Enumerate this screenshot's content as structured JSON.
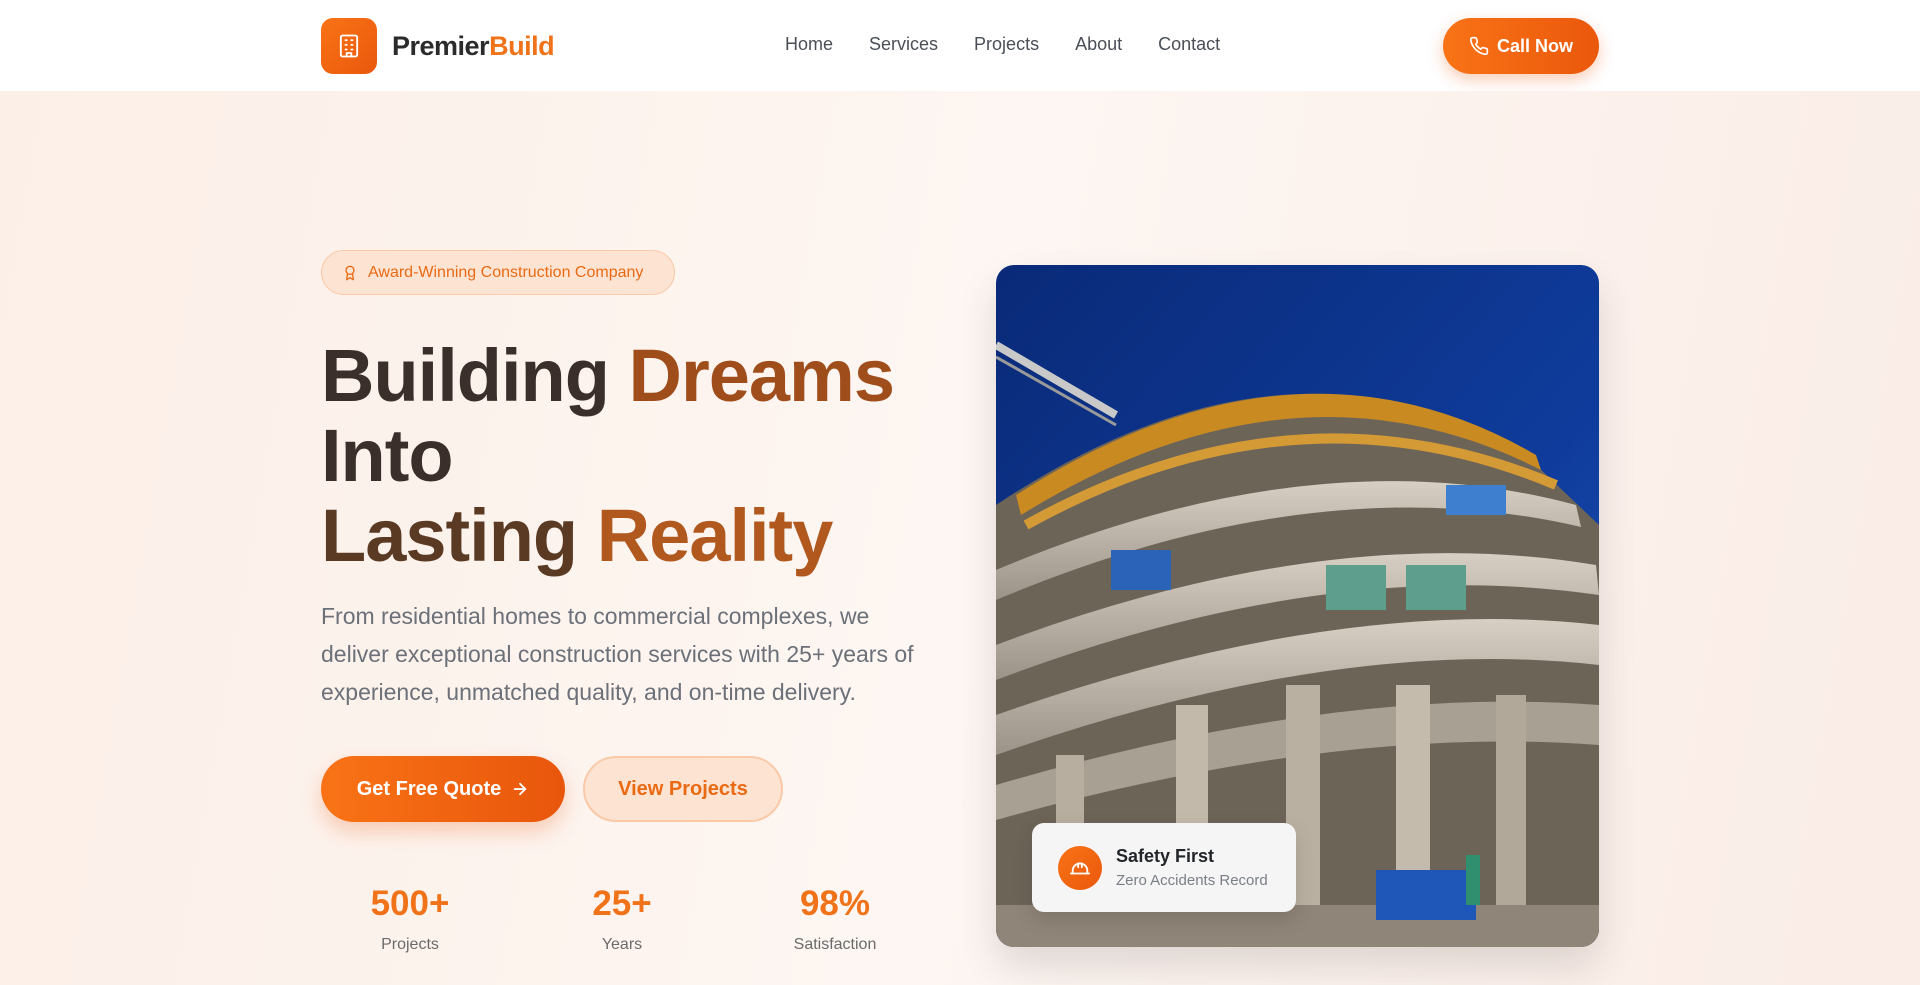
{
  "header": {
    "logo": {
      "part1": "Premier",
      "part2": "Build",
      "icon": "building-icon"
    },
    "nav": [
      {
        "label": "Home"
      },
      {
        "label": "Services"
      },
      {
        "label": "Projects"
      },
      {
        "label": "About"
      },
      {
        "label": "Contact"
      }
    ],
    "cta": {
      "label": "Call Now",
      "icon": "phone-icon"
    }
  },
  "hero": {
    "badge": {
      "label": "Award-Winning Construction Company",
      "icon": "award-icon"
    },
    "headline": {
      "line1_a": "Building",
      "line1_b": "Dreams",
      "line2": "Into",
      "line3_a": "Lasting",
      "line3_b": "Reality"
    },
    "description": "From residential homes to commercial complexes, we deliver exceptional construction services with 25+ years of experience, unmatched quality, and on-time delivery.",
    "primary_button": {
      "label": "Get Free Quote",
      "icon": "arrow-right-icon"
    },
    "secondary_button": {
      "label": "View Projects"
    },
    "stats": [
      {
        "value": "500+",
        "label": "Projects"
      },
      {
        "value": "25+",
        "label": "Years"
      },
      {
        "value": "98%",
        "label": "Satisfaction"
      }
    ],
    "photo": {
      "subject": "construction-site-image"
    },
    "safety_card": {
      "title": "Safety First",
      "subtitle": "Zero Accidents Record",
      "icon": "hard-hat-icon"
    }
  },
  "colors": {
    "accent": "#f97316",
    "accent_dark": "#ea580c",
    "text_dark": "#2b2b2b",
    "background": "#fdf3ee"
  }
}
